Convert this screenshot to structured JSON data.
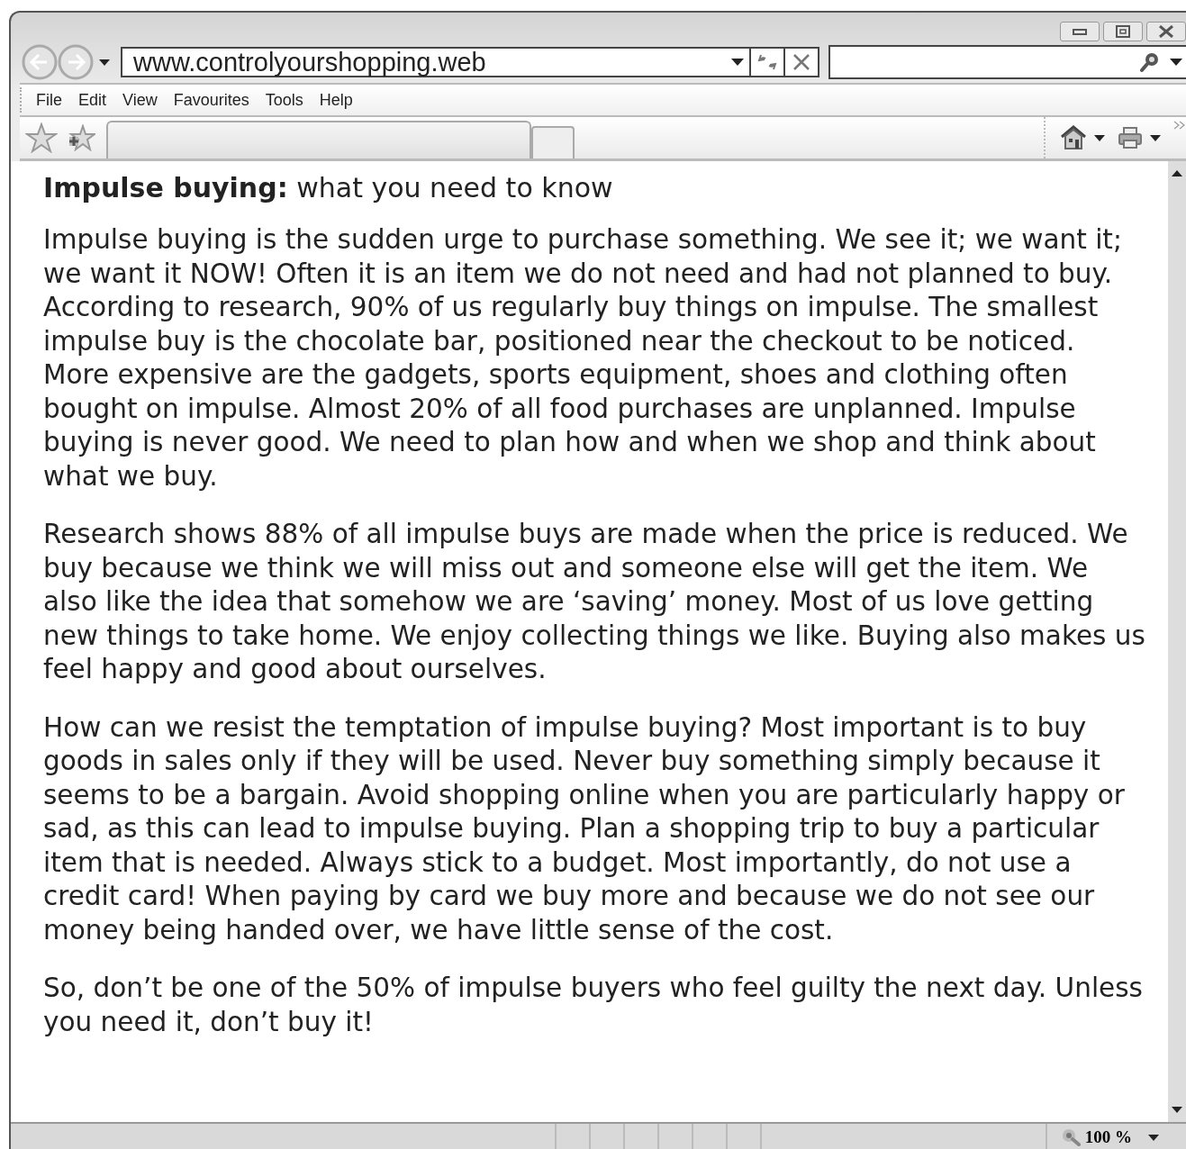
{
  "address_bar": {
    "url": "www.controlyourshopping.web"
  },
  "menu_bar": {
    "items": [
      {
        "label": "File"
      },
      {
        "label": "Edit"
      },
      {
        "label": "View"
      },
      {
        "label": "Favourites"
      },
      {
        "label": "Tools"
      },
      {
        "label": "Help"
      }
    ]
  },
  "page": {
    "heading": "**Impulse buying:** what you need to know",
    "paragraphs": [
      "Impulse buying is the sudden urge to purchase something. We see it; we want it; we want it NOW! Often it is an item we do not need and had not planned to buy. According to research, 90% of us regularly buy things on impulse. The smallest impulse buy is the chocolate bar, positioned near the checkout to be noticed. More expensive are the gadgets, sports equipment, shoes and clothing often bought on impulse. Almost 20% of all food purchases are unplanned. Impulse buying is never good. We need to plan how and when we shop and think about what we buy.",
      "Research shows 88% of all impulse buys are made when the price is reduced. We buy because we think we will miss out and someone else will get the item. We also like the idea that somehow we are ‘saving’ money. Most of us love getting new things to take home. We enjoy collecting things we like. Buying also makes us feel happy and good about ourselves.",
      "How can we resist the temptation of impulse buying? Most important is to buy goods in sales only if they will be used. Never buy something simply because it seems to be a bargain. Avoid shopping online when you are particularly happy or sad, as this can lead to impulse buying. Plan a shopping trip to buy a particular item that is needed. Always stick to a budget. Most importantly, do not use a credit card! When paying by card we buy more and because we do not see our money being handed over, we have little sense of the cost.",
      "So, don’t be one of the 50% of impulse buyers who feel guilty the next day. Unless you need it, don’t buy it!"
    ]
  },
  "status_bar": {
    "zoom": "100 %"
  }
}
